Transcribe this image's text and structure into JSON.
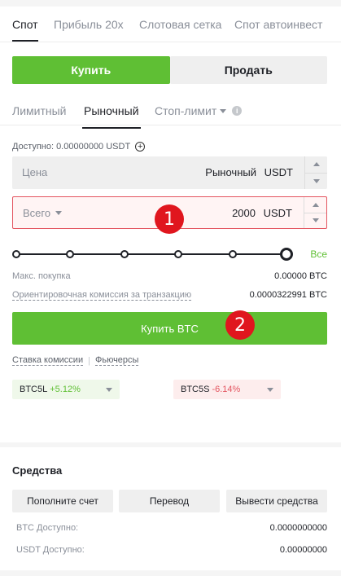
{
  "mode_tabs": [
    "Спот",
    "Прибыль 20x",
    "Слотовая сетка",
    "Спот автоинвест"
  ],
  "side": {
    "buy": "Купить",
    "sell": "Продать"
  },
  "order_tabs": {
    "limit": "Лимитный",
    "market": "Рыночный",
    "stop_limit": "Стоп-лимит",
    "info_icon": "i"
  },
  "available": {
    "label": "Доступно:",
    "value": "0.00000000 USDT",
    "add_icon": "+"
  },
  "price_field": {
    "label": "Цена",
    "value": "Рыночный",
    "unit": "USDT"
  },
  "total_field": {
    "label": "Всего",
    "value": "2000",
    "unit": "USDT"
  },
  "annotations": {
    "badge1": "1",
    "badge2": "2"
  },
  "slider": {
    "level_fraction": 1.0,
    "all_label": "Все"
  },
  "max_buy": {
    "label": "Макс. покупка",
    "value": "0.00000 BTC"
  },
  "fee": {
    "label": "Ориентировочная комиссия за транзакцию",
    "value": "0.0000322991 BTC"
  },
  "buy_button": "Купить BTC",
  "links": {
    "fee_rate": "Ставка комиссии",
    "separator": "|",
    "futures": "Фьючерсы"
  },
  "etf": {
    "long": {
      "name": "BTC5L",
      "change": "+5.12%"
    },
    "short": {
      "name": "BTC5S",
      "change": "-6.14%"
    }
  },
  "funds": {
    "title": "Средства",
    "buttons": [
      "Пополните счет",
      "Перевод",
      "Вывести средства"
    ],
    "balances": [
      {
        "label": "BTC Доступно:",
        "value": "0.0000000000"
      },
      {
        "label": "USDT Доступно:",
        "value": "0.00000000"
      }
    ]
  },
  "colors": {
    "accent_green": "#5fbf34",
    "danger_red": "#e3545f",
    "badge_red": "#e0161e"
  }
}
